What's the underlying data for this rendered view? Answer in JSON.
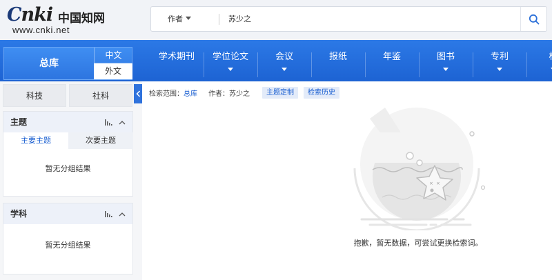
{
  "logo": {
    "brand": "cnki",
    "name_cn": "中国知网",
    "url": "www.cnki.net"
  },
  "search": {
    "field": "作者",
    "query": "苏少之"
  },
  "nav": {
    "db": "总库",
    "lang_zh": "中文",
    "lang_wai": "外文",
    "items": [
      {
        "label": "学术期刊",
        "dropdown": false
      },
      {
        "label": "学位论文",
        "dropdown": true
      },
      {
        "label": "会议",
        "dropdown": true
      },
      {
        "label": "报纸",
        "dropdown": false
      },
      {
        "label": "年鉴",
        "dropdown": false
      },
      {
        "label": "图书",
        "dropdown": true
      },
      {
        "label": "专利",
        "dropdown": true
      },
      {
        "label": "标",
        "dropdown": true
      }
    ]
  },
  "sidebar": {
    "tabs": [
      "科技",
      "社科"
    ],
    "topic": {
      "title": "主题",
      "subtabs": [
        "主要主题",
        "次要主题"
      ],
      "empty": "暂无分组结果"
    },
    "subject": {
      "title": "学科",
      "empty": "暂无分组结果"
    }
  },
  "main": {
    "scope_label": "检索范围：",
    "scope_value": "总库",
    "author_label": "作者：",
    "author_value": "苏少之",
    "chips": [
      "主题定制",
      "检索历史"
    ],
    "empty_msg": "抱歉，暂无数据，可尝试更换检索词。"
  },
  "colors": {
    "primary": "#1d63d3",
    "accent": "#1a5fd1",
    "chip_bg": "#e3ebf9"
  }
}
